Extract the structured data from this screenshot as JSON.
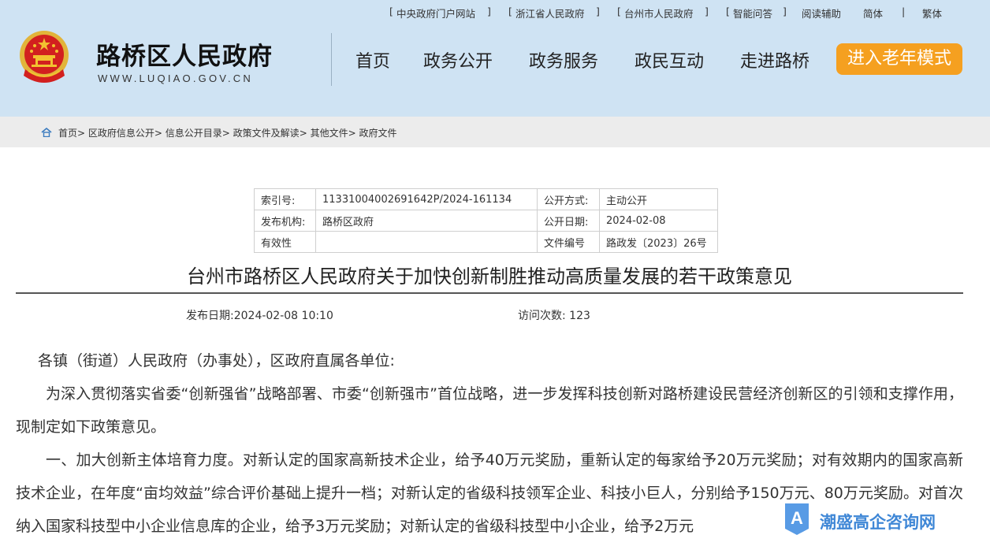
{
  "header": {
    "site_name": "路桥区人民政府",
    "site_url": "WWW.LUQIAO.GOV.CN",
    "top_links": [
      "中央政府门户网站",
      "浙江省人民政府",
      "台州市人民政府",
      "智能问答",
      "阅读辅助",
      "简体",
      "繁体"
    ],
    "nav": [
      "首页",
      "政务公开",
      "政务服务",
      "政民互动",
      "走进路桥"
    ],
    "elder_mode_label": "进入老年模式"
  },
  "breadcrumb": [
    "首页",
    "区政府信息公开",
    "信息公开目录",
    "政策文件及解读",
    "其他文件",
    "政府文件"
  ],
  "meta": {
    "index_label": "索引号:",
    "index_value": "11331004002691642P/2024-161134",
    "method_label": "公开方式:",
    "method_value": "主动公开",
    "publisher_label": "发布机构:",
    "publisher_value": "路桥区政府",
    "open_date_label": "公开日期:",
    "open_date_value": "2024-02-08",
    "validity_label": "有效性",
    "validity_value": "",
    "doc_no_label": "文件编号",
    "doc_no_value": "路政发〔2023〕26号"
  },
  "article": {
    "title": "台州市路桥区人民政府关于加快创新制胜推动高质量发展的若干政策意见",
    "publish_time_label": "发布日期:",
    "publish_time": "2024-02-08 10:10",
    "visits_label": "访问次数:",
    "visits": "123",
    "salutation": "各镇（街道）人民政府（办事处），区政府直属各单位:",
    "para1": "为深入贯彻落实省委“创新强省”战略部署、市委“创新强市”首位战略，进一步发挥科技创新对路桥建设民营经济创新区的引领和支撑作用，现制定如下政策意见。",
    "para2": "一、加大创新主体培育力度。对新认定的国家高新技术企业，给予40万元奖励，重新认定的每家给予20万元奖励；对有效期内的国家高新技术企业，在年度“亩均效益”综合评价基础上提升一档；对新认定的省级科技领军企业、科技小巨人，分别给予150万元、80万元奖励。对首次纳入国家科技型中小企业信息库的企业，给予3万元奖励；对新认定的省级科技型中小企业，给予2万元"
  },
  "watermark": {
    "text": "潮盛高企咨询网",
    "logo_letter": "A"
  },
  "colors": {
    "header_bg": "#cfe3f3",
    "elder_button": "#f5a020",
    "breadcrumb_bg": "#ececec",
    "watermark": "#2f7dd3"
  },
  "icons": {
    "emblem": "national-emblem-icon",
    "home": "home-icon"
  }
}
